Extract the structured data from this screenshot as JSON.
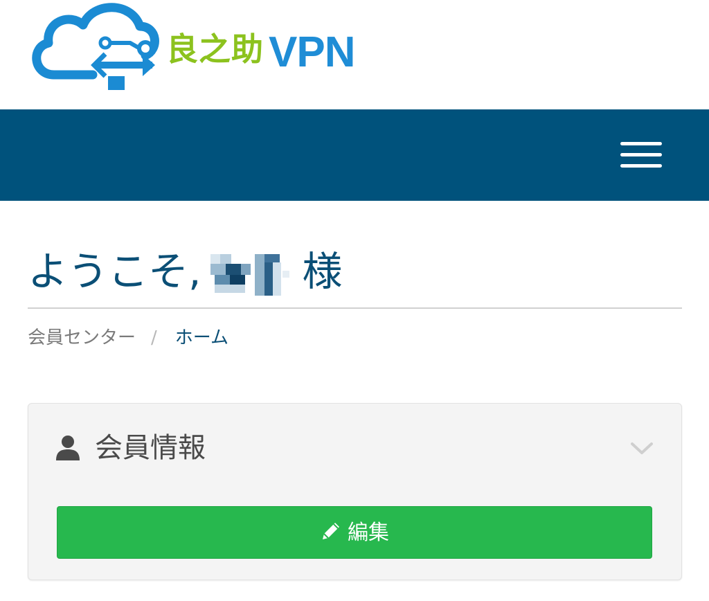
{
  "brand": {
    "name_cn": "良之助",
    "name_vpn": "VPN",
    "colors": {
      "cloud": "#1b8bd3",
      "cn_text": "#8cc21e",
      "vpn_text": "#1f8dd6"
    },
    "icon": "cloud-arrows-logo"
  },
  "navbar": {
    "background": "#00527c",
    "menu_icon": "hamburger-menu-icon"
  },
  "greeting": {
    "prefix": "ようこそ,",
    "name_masked": true,
    "suffix": "様"
  },
  "breadcrumb": {
    "items": [
      "会員センター",
      "ホーム"
    ],
    "separator": "/"
  },
  "panel": {
    "title": "会員情報",
    "title_icon": "user-icon",
    "toggle_icon": "chevron-down-icon",
    "edit_button": {
      "label": "編集",
      "icon": "pencil-icon",
      "color": "#27b84e"
    }
  }
}
